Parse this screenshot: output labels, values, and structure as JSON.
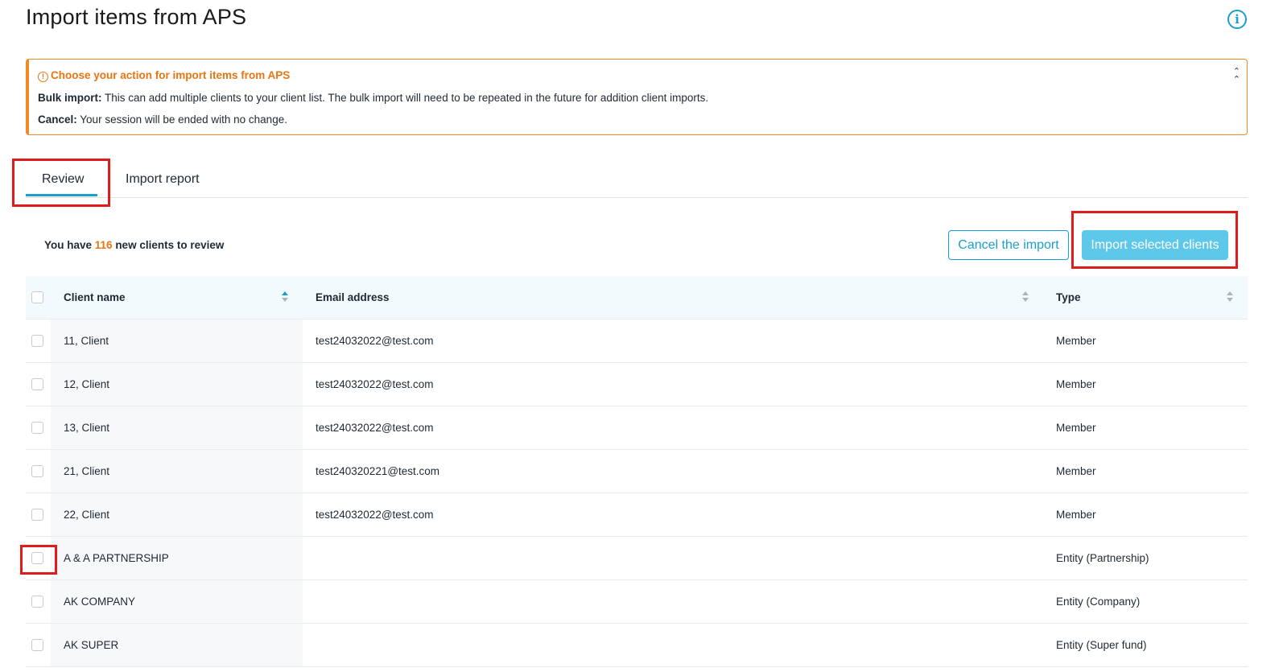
{
  "page": {
    "title": "Import items from APS",
    "info_icon": "info-icon"
  },
  "alert": {
    "title": "Choose your action for import items from APS",
    "warning_icon": "warning-icon",
    "bulk_label": "Bulk import:",
    "bulk_text": " This can add multiple clients to your client list. The bulk import will need to be repeated in the future for addition client imports.",
    "cancel_label": "Cancel:",
    "cancel_text": " Your session will be ended with no change.",
    "collapse_icon": "chevron-double-up-icon",
    "accent_color": "#f08a24"
  },
  "tabs": [
    {
      "label": "Review",
      "active": true
    },
    {
      "label": "Import report",
      "active": false
    }
  ],
  "summary": {
    "prefix": "You have ",
    "count": "116",
    "suffix": " new clients to review"
  },
  "actions": {
    "cancel_label": "Cancel the import",
    "import_label": "Import selected clients",
    "primary_color": "#1a9fd0"
  },
  "table": {
    "columns": [
      {
        "label": "Client name",
        "sort": "ascending"
      },
      {
        "label": "Email address",
        "sort": "none"
      },
      {
        "label": "Type",
        "sort": "none"
      }
    ],
    "rows": [
      {
        "name": "11, Client",
        "email": "test24032022@test.com",
        "type": "Member"
      },
      {
        "name": "12, Client",
        "email": "test24032022@test.com",
        "type": "Member"
      },
      {
        "name": "13, Client",
        "email": "test24032022@test.com",
        "type": "Member"
      },
      {
        "name": "21, Client",
        "email": "test240320221@test.com",
        "type": "Member"
      },
      {
        "name": "22, Client",
        "email": "test24032022@test.com",
        "type": "Member"
      },
      {
        "name": "A & A PARTNERSHIP",
        "email": "",
        "type": "Entity (Partnership)"
      },
      {
        "name": "AK COMPANY",
        "email": "",
        "type": "Entity (Company)"
      },
      {
        "name": "AK SUPER",
        "email": "",
        "type": "Entity (Super fund)"
      }
    ]
  }
}
